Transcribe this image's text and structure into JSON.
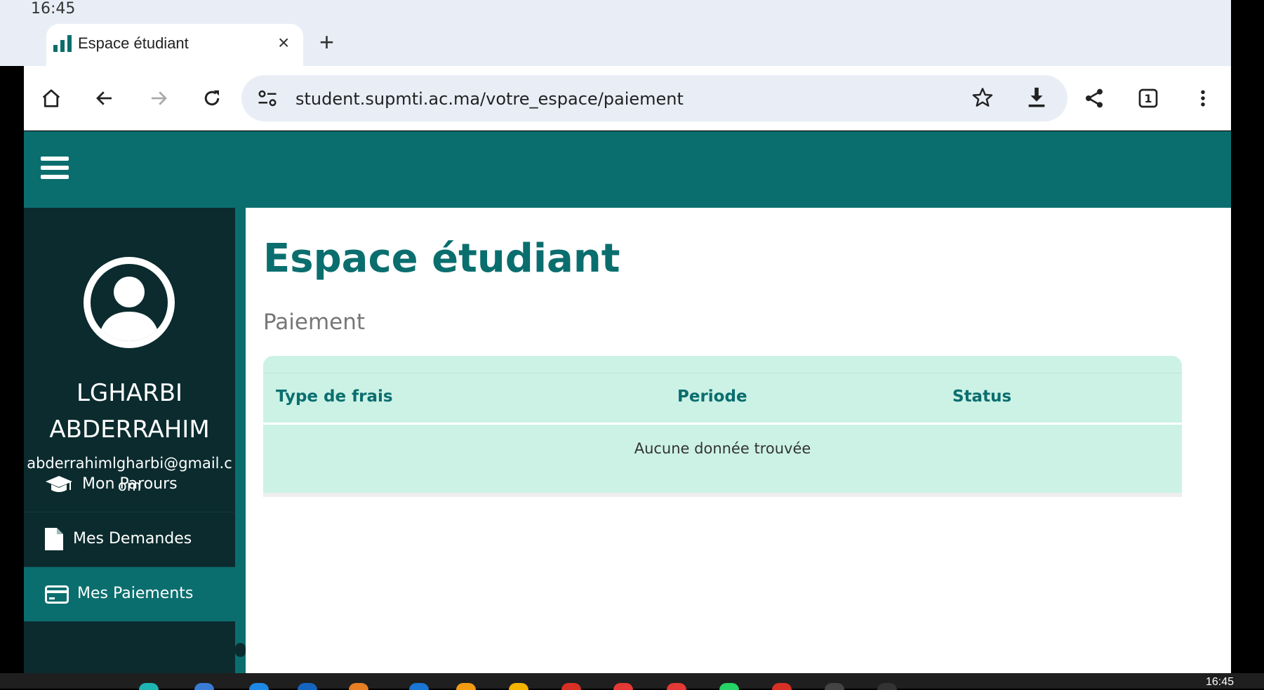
{
  "status": {
    "time": "16:45"
  },
  "tab": {
    "title": "Espace étudiant",
    "close": "×",
    "new_tab": "+"
  },
  "address": {
    "url": "student.supmti.ac.ma/votre_espace/paiement"
  },
  "toolbar": {
    "tab_count": "1"
  },
  "sidebar": {
    "user_name": "LGHARBI ABDERRAHIM",
    "email": "abderrahimlgharbi@gmail.com",
    "items": [
      {
        "label": "Mon Parours",
        "icon": "graduation-cap-icon"
      },
      {
        "label": "Mes Demandes",
        "icon": "file-icon"
      },
      {
        "label": "Mes Paiements",
        "icon": "credit-card-icon",
        "active": true
      }
    ]
  },
  "main": {
    "title": "Espace étudiant",
    "subtitle": "Paiement",
    "table": {
      "columns": [
        "Type de frais",
        "Periode",
        "Status"
      ],
      "empty_message": "Aucune donnée trouvée"
    }
  },
  "taskbar": {
    "time": "16:45"
  },
  "colors": {
    "primary": "#0b6e6e",
    "sidebar": "#0b2b2e",
    "table_bg": "#ccf2e6"
  }
}
